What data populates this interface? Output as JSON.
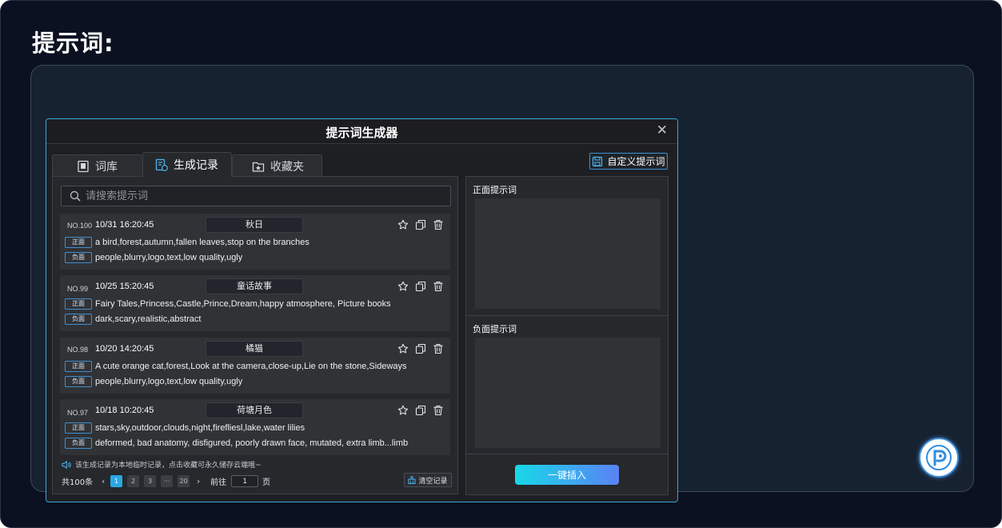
{
  "page": {
    "heading": "提示词:"
  },
  "dialog": {
    "title": "提示词生成器",
    "close_glyph": "✕",
    "tabs": [
      {
        "label": "词库",
        "icon": "book-icon"
      },
      {
        "label": "生成记录",
        "icon": "history-list-icon",
        "active": true
      },
      {
        "label": "收藏夹",
        "icon": "folder-star-icon"
      }
    ],
    "custom_button": "自定义提示词",
    "search": {
      "placeholder": "请搜索提示词",
      "value": ""
    },
    "tag_positive": "正面",
    "tag_negative": "负面",
    "records": [
      {
        "no": "NO.100",
        "time": "10/31  16:20:45",
        "name": "秋日",
        "positive": "a bird,forest,autumn,fallen leaves,stop on the branches",
        "negative": "people,blurry,logo,text,low quality,ugly"
      },
      {
        "no": "NO.99",
        "time": "10/25  15:20:45",
        "name": "童话故事",
        "positive": "Fairy Tales,Princess,Castle,Prince,Dream,happy atmosphere,  Picture books",
        "negative": "dark,scary,realistic,abstract"
      },
      {
        "no": "NO.98",
        "time": "10/20  14:20:45",
        "name": "橘猫",
        "positive": "A cute orange cat,forest,Look at the camera,close-up,Lie on the stone,Sideways",
        "negative": "people,blurry,logo,text,low quality,ugly"
      },
      {
        "no": "NO.97",
        "time": "10/18  10:20:45",
        "name": "荷塘月色",
        "positive": "stars,sky,outdoor,clouds,night,firefliesl,lake,water lilies",
        "negative": "deformed, bad anatomy, disfigured, poorly drawn face, mutated, extra limb...limb"
      }
    ],
    "notice": "该生成记录为本地临时记录，点击收藏可永久储存云端哦~",
    "pagination": {
      "total": "共100条",
      "prev": "‹",
      "next": "›",
      "pages": [
        "1",
        "2",
        "3",
        "···",
        "20"
      ],
      "current": "1",
      "goto_label": "前往",
      "goto_value": "1",
      "page_unit": "页"
    },
    "clear_button": "清空记录",
    "right": {
      "positive_label": "正面提示词",
      "negative_label": "负面提示词",
      "insert_button": "一键插入"
    }
  },
  "colors": {
    "accent": "#2aa7e6",
    "dialog_border": "#35a8d8",
    "tag_border": "#3f8fd0",
    "insert_gradient_start": "#18d8e8",
    "insert_gradient_end": "#5a82f5"
  }
}
